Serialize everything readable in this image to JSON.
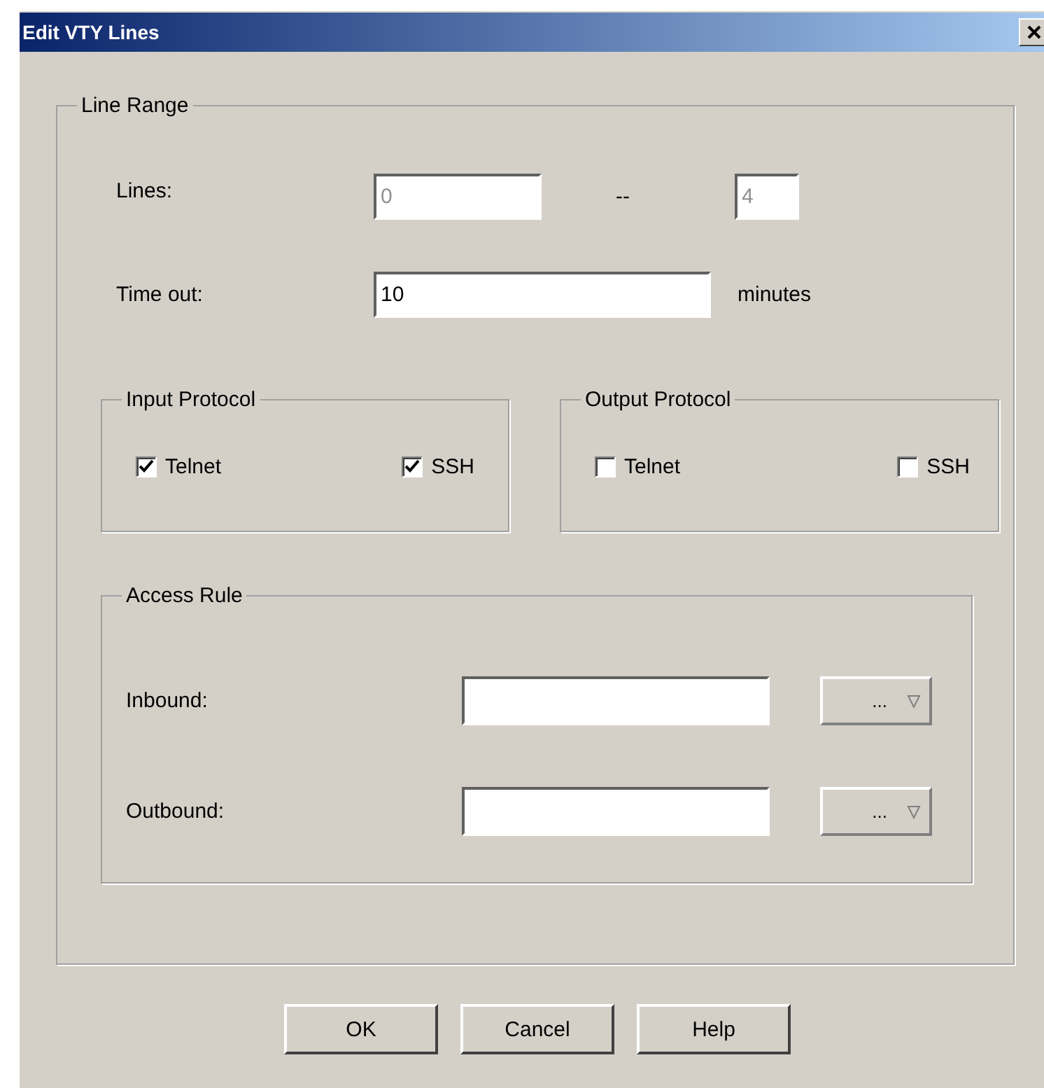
{
  "window": {
    "title": "Edit VTY Lines"
  },
  "line_range": {
    "legend": "Line Range",
    "lines_label": "Lines:",
    "lines_from": {
      "value": "0",
      "disabled": true
    },
    "separator": "--",
    "lines_to": {
      "value": "4",
      "disabled": true
    },
    "timeout_label": "Time out:",
    "timeout": {
      "value": "10",
      "disabled": false
    },
    "unit": "minutes"
  },
  "protocols": [
    {
      "legend": "Input Protocol",
      "options": [
        {
          "label": "Telnet",
          "checked": true
        },
        {
          "label": "SSH",
          "checked": true
        }
      ]
    },
    {
      "legend": "Output Protocol",
      "options": [
        {
          "label": "Telnet",
          "checked": false
        },
        {
          "label": "SSH",
          "checked": false
        }
      ]
    }
  ],
  "access_rule": {
    "legend": "Access Rule",
    "rows": [
      {
        "label": "Inbound:",
        "dropdown": "..."
      },
      {
        "label": "Outbound:",
        "dropdown": "..."
      }
    ]
  },
  "buttons": [
    "OK",
    "Cancel",
    "Help"
  ]
}
